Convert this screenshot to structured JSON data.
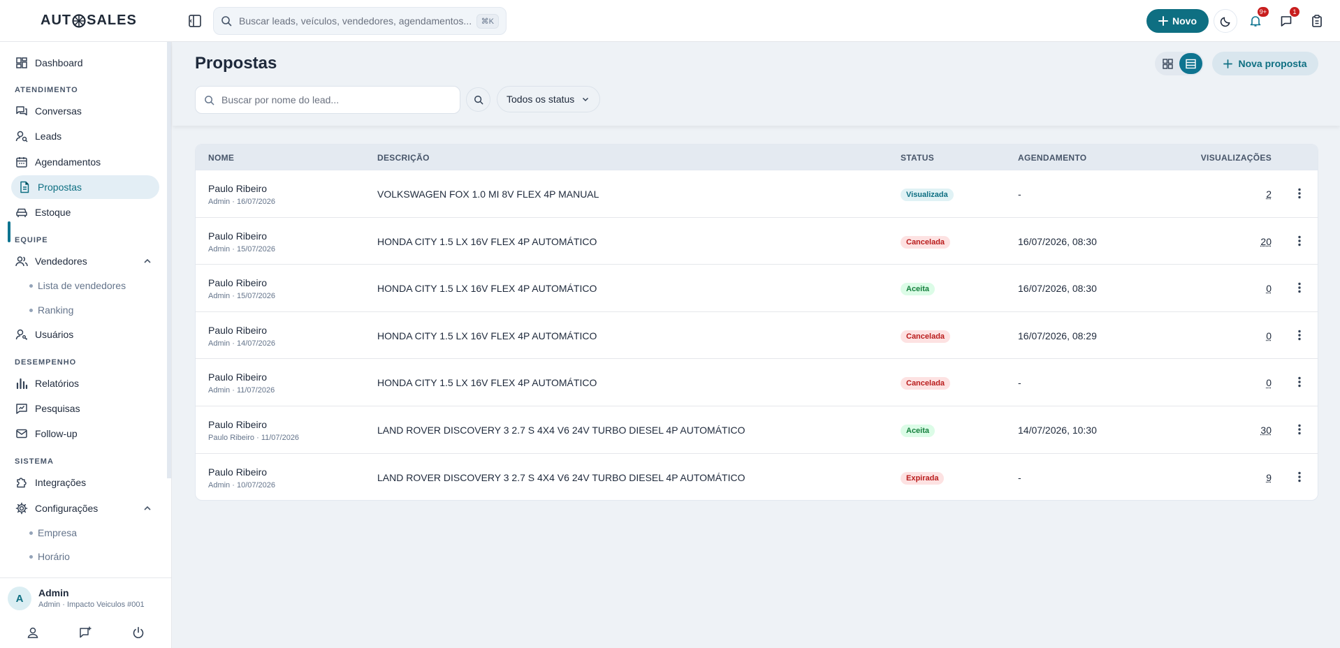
{
  "brand": {
    "logo_text_left": "AUT",
    "logo_text_right": "SALES"
  },
  "topbar": {
    "search_placeholder": "Buscar leads, veículos, vendedores, agendamentos...",
    "shortcut": "⌘K",
    "new_label": "Novo",
    "notifications_badge": "9+",
    "messages_badge": "1"
  },
  "sidebar": {
    "dashboard": "Dashboard",
    "sec_atendimento": "ATENDIMENTO",
    "conversas": "Conversas",
    "leads": "Leads",
    "agendamentos": "Agendamentos",
    "propostas": "Propostas",
    "estoque": "Estoque",
    "sec_equipe": "EQUIPE",
    "vendedores": "Vendedores",
    "lista_vendedores": "Lista de vendedores",
    "ranking": "Ranking",
    "usuarios": "Usuários",
    "sec_desempenho": "DESEMPENHO",
    "relatorios": "Relatórios",
    "pesquisas": "Pesquisas",
    "followup": "Follow-up",
    "sec_sistema": "SISTEMA",
    "integracoes": "Integrações",
    "configuracoes": "Configurações",
    "empresa": "Empresa",
    "horario": "Horário",
    "user": {
      "initial": "A",
      "name": "Admin",
      "subtitle": "Admin · Impacto Veiculos #001"
    }
  },
  "page": {
    "title": "Propostas",
    "new_proposal": "Nova proposta",
    "filter_placeholder": "Buscar por nome do lead...",
    "status_filter": "Todos os status"
  },
  "table": {
    "headers": {
      "nome": "NOME",
      "descricao": "DESCRIÇÃO",
      "status": "STATUS",
      "agendamento": "AGENDAMENTO",
      "visualizacoes": "VISUALIZAÇÕES"
    },
    "rows": [
      {
        "name": "Paulo Ribeiro",
        "meta": "Admin · 16/07/2026",
        "desc": "VOLKSWAGEN FOX 1.0 MI 8V FLEX 4P MANUAL",
        "status": "Visualizada",
        "status_kind": "vis",
        "agendamento": "-",
        "views": "2"
      },
      {
        "name": "Paulo Ribeiro",
        "meta": "Admin · 15/07/2026",
        "desc": "HONDA CITY 1.5 LX 16V FLEX 4P AUTOMÁTICO",
        "status": "Cancelada",
        "status_kind": "can",
        "agendamento": "16/07/2026, 08:30",
        "views": "20"
      },
      {
        "name": "Paulo Ribeiro",
        "meta": "Admin · 15/07/2026",
        "desc": "HONDA CITY 1.5 LX 16V FLEX 4P AUTOMÁTICO",
        "status": "Aceita",
        "status_kind": "ace",
        "agendamento": "16/07/2026, 08:30",
        "views": "0"
      },
      {
        "name": "Paulo Ribeiro",
        "meta": "Admin · 14/07/2026",
        "desc": "HONDA CITY 1.5 LX 16V FLEX 4P AUTOMÁTICO",
        "status": "Cancelada",
        "status_kind": "can",
        "agendamento": "16/07/2026, 08:29",
        "views": "0"
      },
      {
        "name": "Paulo Ribeiro",
        "meta": "Admin · 11/07/2026",
        "desc": "HONDA CITY 1.5 LX 16V FLEX 4P AUTOMÁTICO",
        "status": "Cancelada",
        "status_kind": "can",
        "agendamento": "-",
        "views": "0"
      },
      {
        "name": "Paulo Ribeiro",
        "meta": "Paulo Ribeiro · 11/07/2026",
        "desc": "LAND ROVER DISCOVERY 3 2.7 S 4X4 V6 24V TURBO DIESEL 4P AUTOMÁTICO",
        "status": "Aceita",
        "status_kind": "ace",
        "agendamento": "14/07/2026, 10:30",
        "views": "30"
      },
      {
        "name": "Paulo Ribeiro",
        "meta": "Admin · 10/07/2026",
        "desc": "LAND ROVER DISCOVERY 3 2.7 S 4X4 V6 24V TURBO DIESEL 4P AUTOMÁTICO",
        "status": "Expirada",
        "status_kind": "exp",
        "agendamento": "-",
        "views": "9"
      }
    ]
  },
  "colors": {
    "accent": "#0e6f82",
    "danger": "#b91c1c",
    "success": "#15803d"
  }
}
